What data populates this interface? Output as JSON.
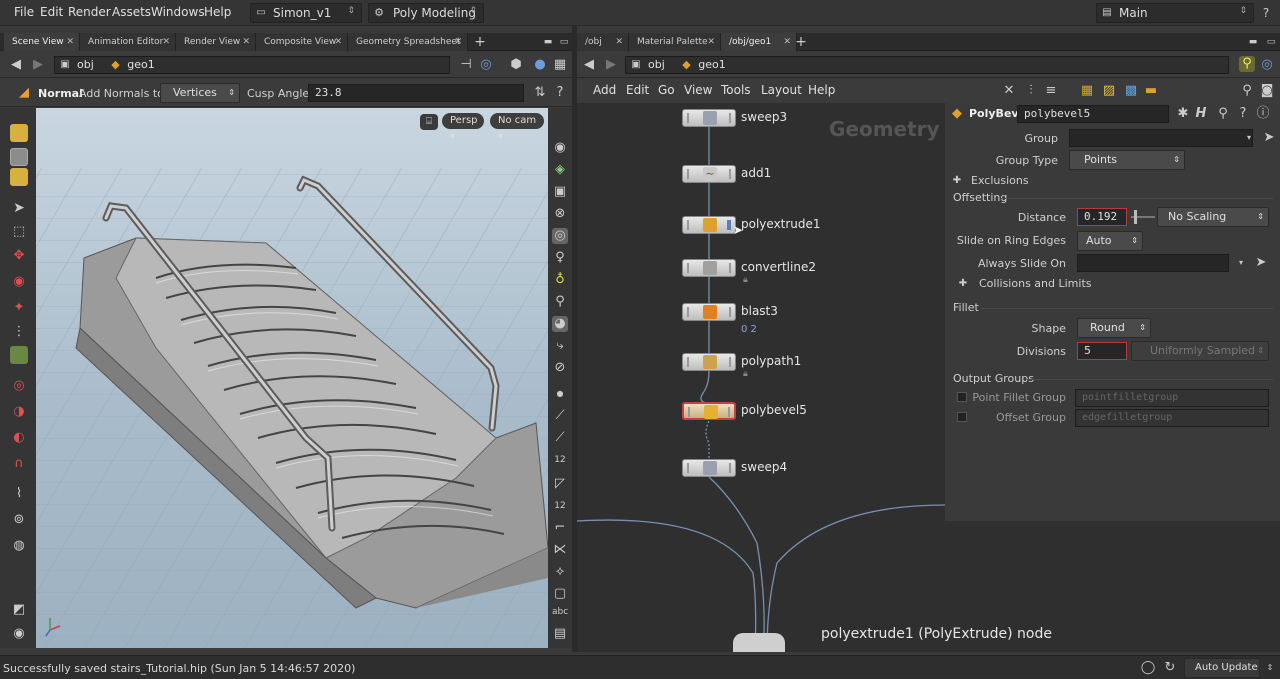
{
  "menubar": {
    "items": [
      "File",
      "Edit",
      "Render",
      "Assets",
      "Windows",
      "Help"
    ],
    "desktop": "Simon_v1",
    "shelf_set": "Poly Modeling",
    "takes": "Main"
  },
  "left_pane": {
    "tabs": [
      "Scene View",
      "Animation Editor",
      "Render View",
      "Composite View",
      "Geometry Spreadsheet"
    ],
    "path_obj": "obj",
    "path_geo": "geo1",
    "tool": {
      "mode": "Normal",
      "add_normals_label": "Add Normals to",
      "add_normals_value": "Vertices",
      "cusp_label": "Cusp Angle",
      "cusp_value": "23.8"
    },
    "viewport": {
      "camera_persp": "Persp",
      "camera_nocam": "No cam"
    }
  },
  "right_pane": {
    "tabs": [
      "/obj",
      "Material Palette",
      "/obj/geo1"
    ],
    "path_obj": "obj",
    "path_geo": "geo1",
    "network_menu": [
      "Add",
      "Edit",
      "Go",
      "View",
      "Tools",
      "Layout",
      "Help"
    ],
    "network_label": "Geometry",
    "nodes": [
      {
        "name": "sweep3",
        "color": "#9aa0b0",
        "sub": ""
      },
      {
        "name": "add1",
        "color": "#c8c8c8",
        "sub": ""
      },
      {
        "name": "polyextrude1",
        "color": "#e0a030",
        "sub": ""
      },
      {
        "name": "convertline2",
        "color": "#a0a0a0",
        "sub": ""
      },
      {
        "name": "blast3",
        "color": "#e08020",
        "sub": "0 2"
      },
      {
        "name": "polypath1",
        "color": "#d0a050",
        "sub": ""
      },
      {
        "name": "polybevel5",
        "color": "#e8b030",
        "sub": ""
      },
      {
        "name": "sweep4",
        "color": "#9aa0b0",
        "sub": ""
      }
    ],
    "info_text": "polyextrude1 (PolyExtrude) node"
  },
  "params": {
    "type": "PolyBevel",
    "name": "polybevel5",
    "group_label": "Group",
    "group_value": "",
    "group_type_label": "Group Type",
    "group_type_value": "Points",
    "exclusions": "Exclusions",
    "offsetting": "Offsetting",
    "distance_label": "Distance",
    "distance_value": "0.192",
    "scaling_value": "No Scaling",
    "slide_label": "Slide on Ring Edges",
    "slide_value": "Auto",
    "always_slide_label": "Always Slide On",
    "collisions": "Collisions and Limits",
    "fillet": "Fillet",
    "shape_label": "Shape",
    "shape_value": "Round",
    "divisions_label": "Divisions",
    "divisions_value": "5",
    "sampling_value": "Uniformly Sampled",
    "output_groups": "Output Groups",
    "point_fillet_label": "Point Fillet Group",
    "point_fillet_value": "pointfilletgroup",
    "offset_group_label": "Offset Group",
    "offset_group_value": "edgefilletgroup"
  },
  "status": {
    "message": "Successfully saved stairs_Tutorial.hip (Sun Jan  5 14:46:57 2020)",
    "auto_update": "Auto Update"
  },
  "colors": {
    "accent_red": "#b83a3a",
    "node_bg": "#d8d8d8",
    "viewport_sky": "#a9bfd0"
  }
}
